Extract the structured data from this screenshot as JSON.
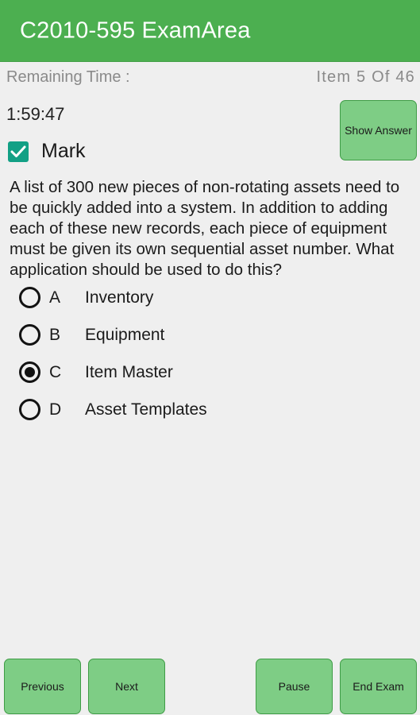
{
  "app": {
    "title": "C2010-595 ExamArea",
    "header_color": "#4CAF50",
    "background_color": "#efefef",
    "accent_color": "#7ecd85",
    "checkbox_color": "#12a085"
  },
  "status": {
    "remaining_time_label": "Remaining Time :",
    "item_counter": "Item 5 Of 46",
    "timer_value": "1:59:47"
  },
  "actions": {
    "show_answer_label": "Show Answer"
  },
  "mark": {
    "label": "Mark",
    "checked": true
  },
  "question": {
    "text": "A list of 300 new pieces of non-rotating assets need to be quickly added into a system. In addition to adding each of these new records, each piece of equipment must be given its own sequential asset number. What application should be used to do this?",
    "options": [
      {
        "letter": "A",
        "label": "Inventory",
        "selected": false
      },
      {
        "letter": "B",
        "label": "Equipment",
        "selected": false
      },
      {
        "letter": "C",
        "label": "Item Master",
        "selected": true
      },
      {
        "letter": "D",
        "label": "Asset Templates",
        "selected": false
      }
    ]
  },
  "bottom_bar": {
    "previous_label": "Previous",
    "next_label": "Next",
    "pause_label": "Pause",
    "end_exam_label": "End Exam"
  }
}
